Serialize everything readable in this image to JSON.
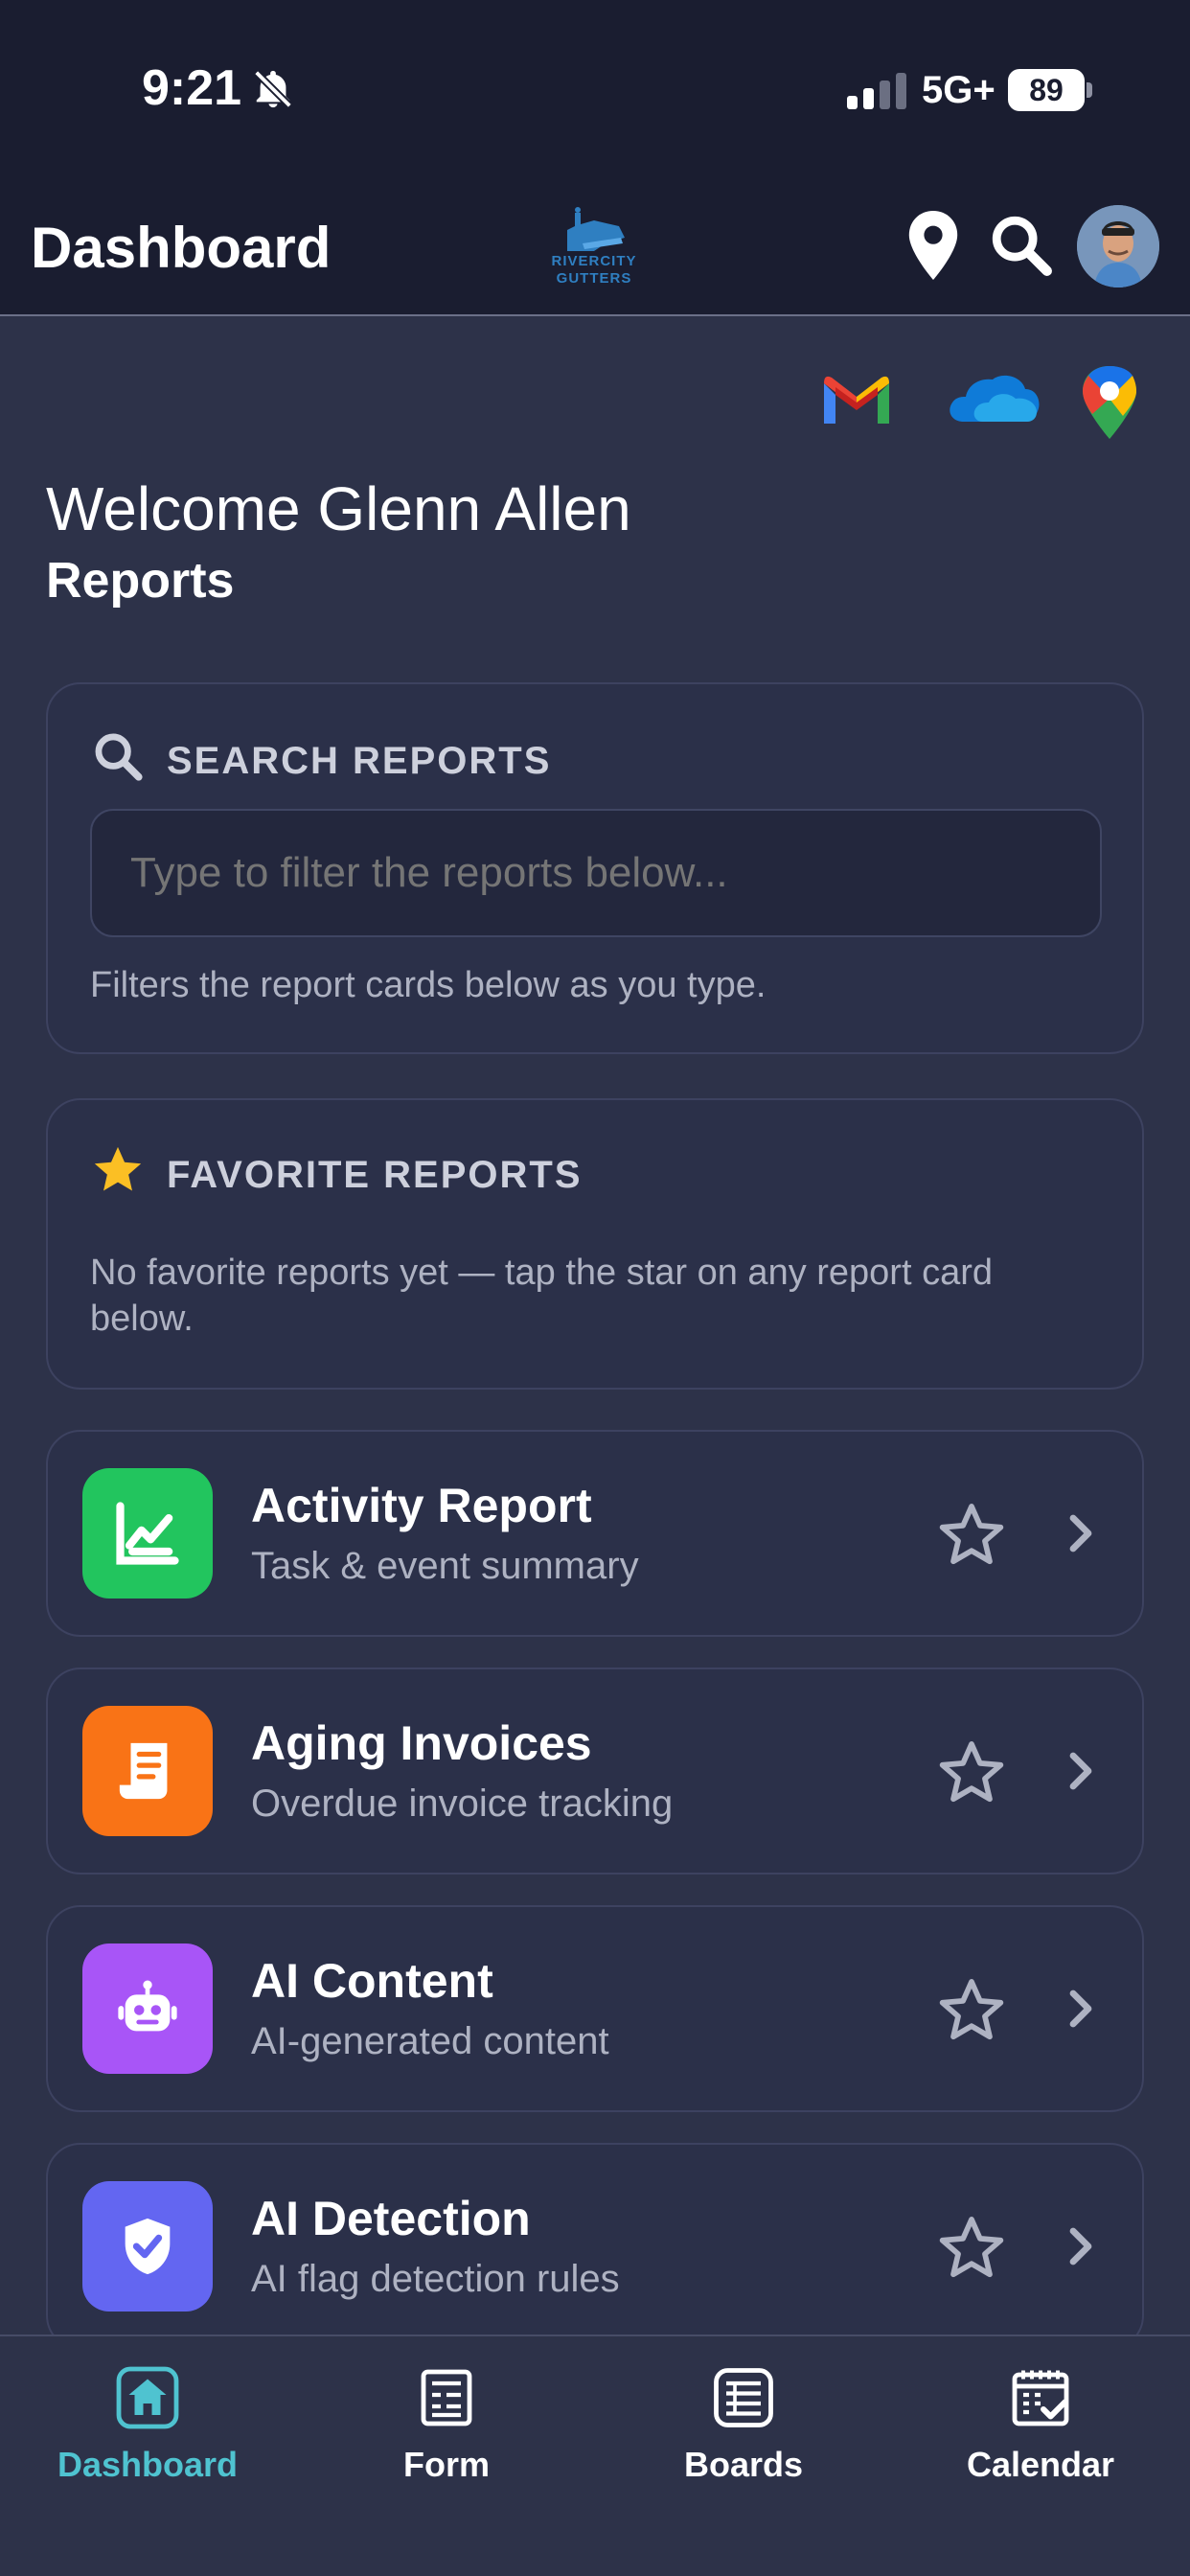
{
  "status_bar": {
    "time": "9:21",
    "network": "5G+",
    "battery": "89"
  },
  "app_bar": {
    "title": "Dashboard",
    "logo_line1": "RIVERCITY",
    "logo_line2": "GUTTERS"
  },
  "quick_links": [
    "gmail-icon",
    "onedrive-icon",
    "google-maps-icon"
  ],
  "welcome": "Welcome Glenn Allen",
  "section_title": "Reports",
  "search": {
    "heading": "SEARCH REPORTS",
    "placeholder": "Type to filter the reports below...",
    "hint": "Filters the report cards below as you type."
  },
  "favorites": {
    "heading": "FAVORITE REPORTS",
    "empty_text": "No favorite reports yet — tap the star on any report card below."
  },
  "reports": [
    {
      "title": "Activity Report",
      "subtitle": "Task & event summary",
      "icon": "chart-line-icon",
      "color": "#22c55e"
    },
    {
      "title": "Aging Invoices",
      "subtitle": "Overdue invoice tracking",
      "icon": "receipt-icon",
      "color": "#f97316"
    },
    {
      "title": "AI Content",
      "subtitle": "AI-generated content",
      "icon": "robot-icon",
      "color": "#a855f7"
    },
    {
      "title": "AI Detection",
      "subtitle": "AI flag detection rules",
      "icon": "shield-check-icon",
      "color": "#6366f1"
    }
  ],
  "tabs": [
    {
      "label": "Dashboard",
      "icon": "home-icon",
      "active": true
    },
    {
      "label": "Form",
      "icon": "form-icon",
      "active": false
    },
    {
      "label": "Boards",
      "icon": "boards-icon",
      "active": false
    },
    {
      "label": "Calendar",
      "icon": "calendar-icon",
      "active": false
    }
  ],
  "colors": {
    "accent": "#4fc3d0",
    "header_bg": "#1a1d30",
    "page_bg": "#2d3249",
    "star": "#fbbf24"
  }
}
